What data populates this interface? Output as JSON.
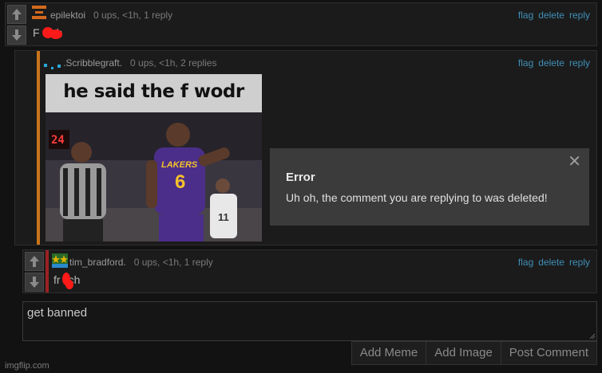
{
  "comments": [
    {
      "username": "epilektoi",
      "meta": "0 ups, <1h, 1 reply",
      "text_pre": "F",
      "text_post": "ch",
      "accent_color": "#1b1b1b",
      "avatar_color": "#d2691e"
    },
    {
      "username": ".Scribblegraft.",
      "meta": "0 ups, <1h, 2 replies",
      "accent_color": "#c8741a",
      "avatar_color": "#2aa8d8",
      "image": {
        "caption": "he said the f wodr",
        "jersey_number": "6",
        "jersey_team": "LAKERS",
        "other_number": "11",
        "shot_clock": "24"
      }
    },
    {
      "username": "tim_bradford.",
      "meta": "0 ups, <1h, 1 reply",
      "text_pre": "fr",
      "text_post": "ch",
      "accent_color": "#9a2222",
      "avatar_color": "#e0b000"
    }
  ],
  "actions": {
    "flag": "flag",
    "delete": "delete",
    "reply": "reply"
  },
  "modal": {
    "title": "Error",
    "message": "Uh oh, the comment you are replying to was deleted!",
    "close": "✕"
  },
  "reply": {
    "value": "get banned"
  },
  "buttons": {
    "add_meme": "Add Meme",
    "add_image": "Add Image",
    "post_comment": "Post Comment"
  },
  "watermark": "imgflip.com"
}
